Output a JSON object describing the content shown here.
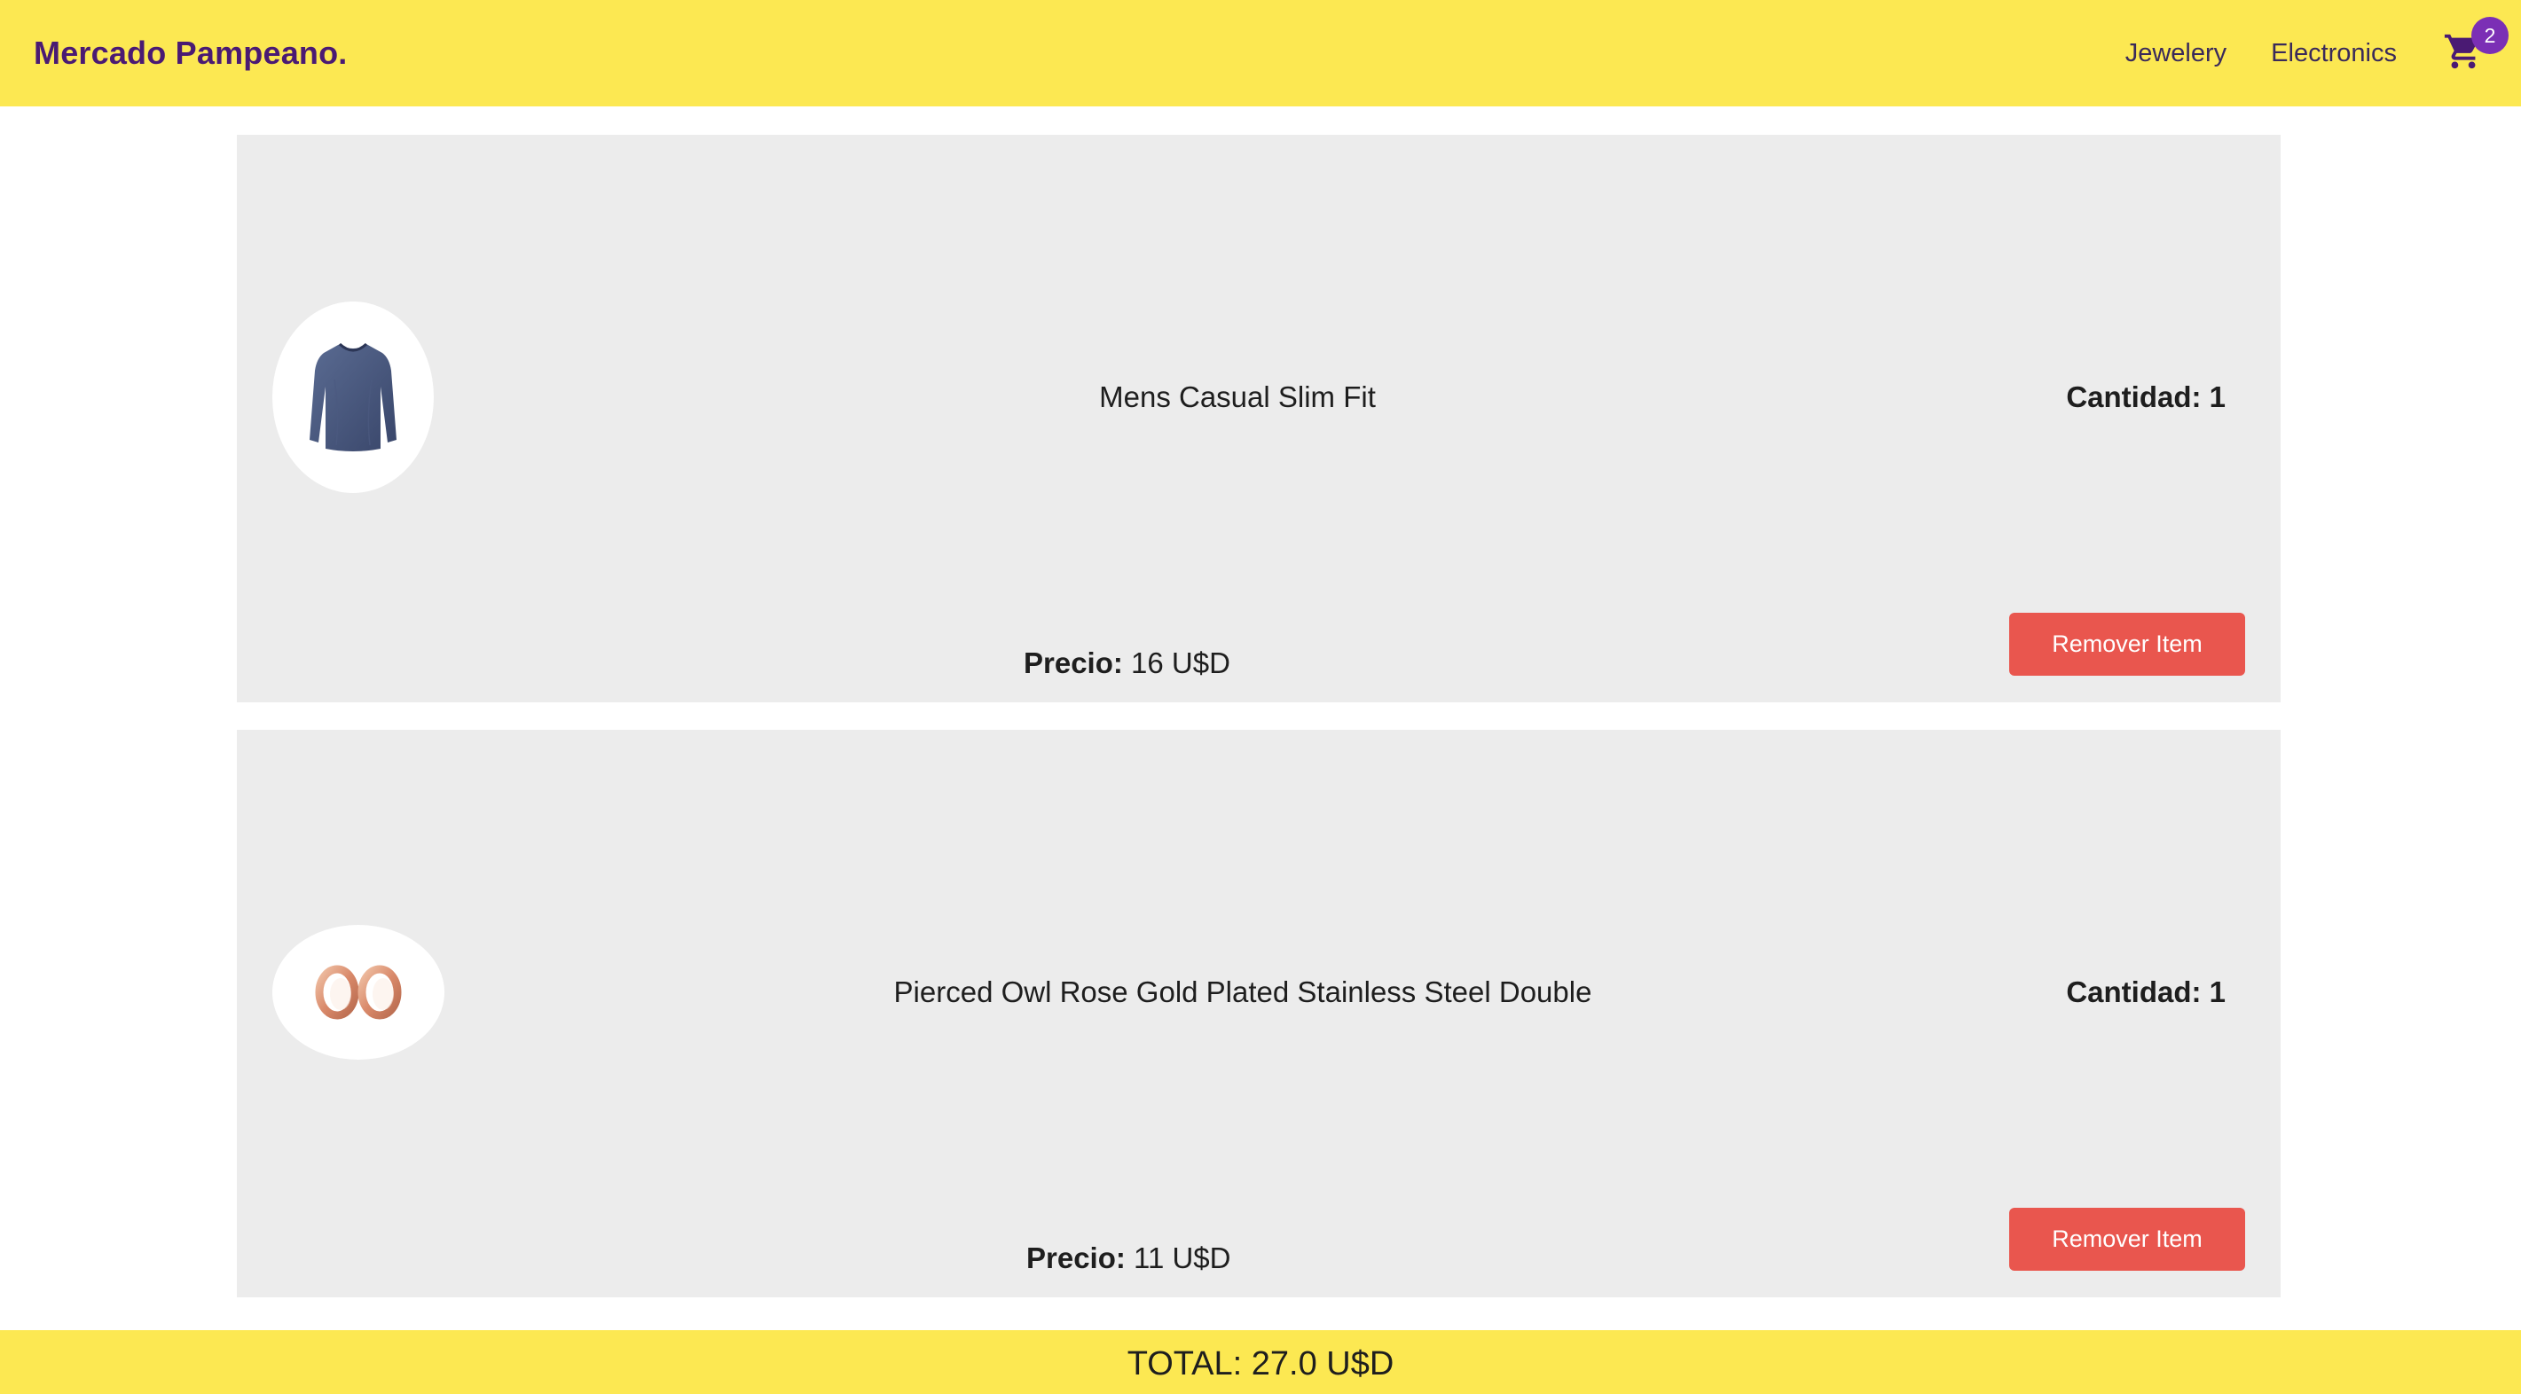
{
  "header": {
    "brand": "Mercado Pampeano.",
    "nav_links": [
      "Jewelery",
      "Electronics"
    ],
    "cart_icon": "shopping-cart-icon",
    "cart_count": "2"
  },
  "cart": {
    "items": [
      {
        "image_icon": "long-sleeve-shirt-image",
        "title": "Mens Casual Slim Fit",
        "quantity_label": "Cantidad: 1",
        "price_label": "Precio:",
        "price_value": "16 U$D",
        "remove_label": "Remover Item"
      },
      {
        "image_icon": "rose-gold-earrings-image",
        "title": "Pierced Owl Rose Gold Plated Stainless Steel Double",
        "quantity_label": "Cantidad: 1",
        "price_label": "Precio:",
        "price_value": "11 U$D",
        "remove_label": "Remover Item"
      }
    ]
  },
  "footer": {
    "total": "TOTAL: 27.0 U$D"
  },
  "colors": {
    "header_bg": "#fce852",
    "brand": "#4a1a73",
    "badge": "#7b2fb5",
    "card_bg": "#ececec",
    "remove_button": "#e9564e"
  }
}
